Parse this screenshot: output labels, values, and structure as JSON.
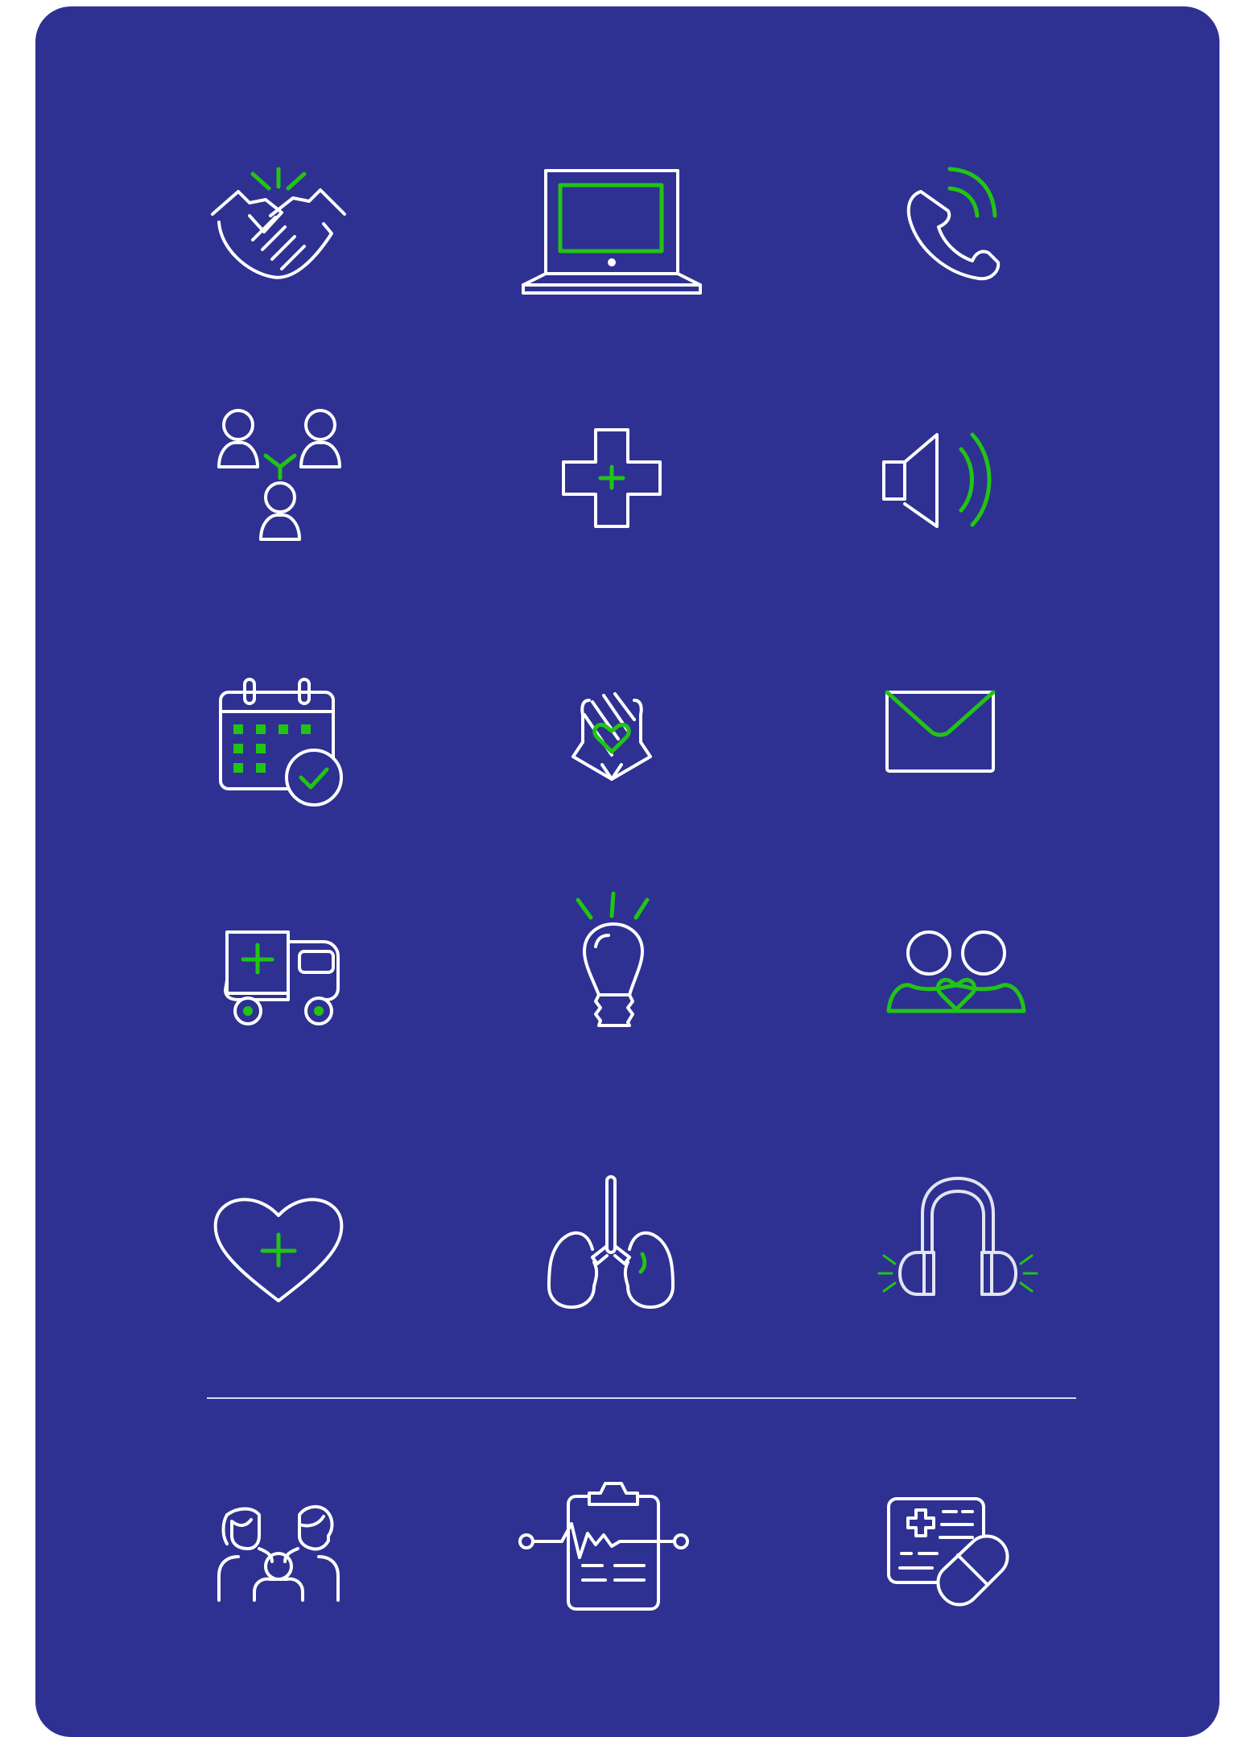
{
  "colors": {
    "background": "#2e3192",
    "stroke": "#ffffff",
    "accent": "#22c414"
  },
  "icons": [
    "handshake-icon",
    "laptop-icon",
    "phone-call-icon",
    "group-connection-icon",
    "medical-cross-icon",
    "speaker-icon",
    "calendar-check-icon",
    "hands-heart-icon",
    "envelope-icon",
    "ambulance-icon",
    "lightbulb-icon",
    "couple-heart-icon",
    "heart-plus-icon",
    "lungs-icon",
    "headphones-icon",
    "family-icon",
    "clipboard-heartbeat-icon",
    "prescription-pill-icon"
  ]
}
